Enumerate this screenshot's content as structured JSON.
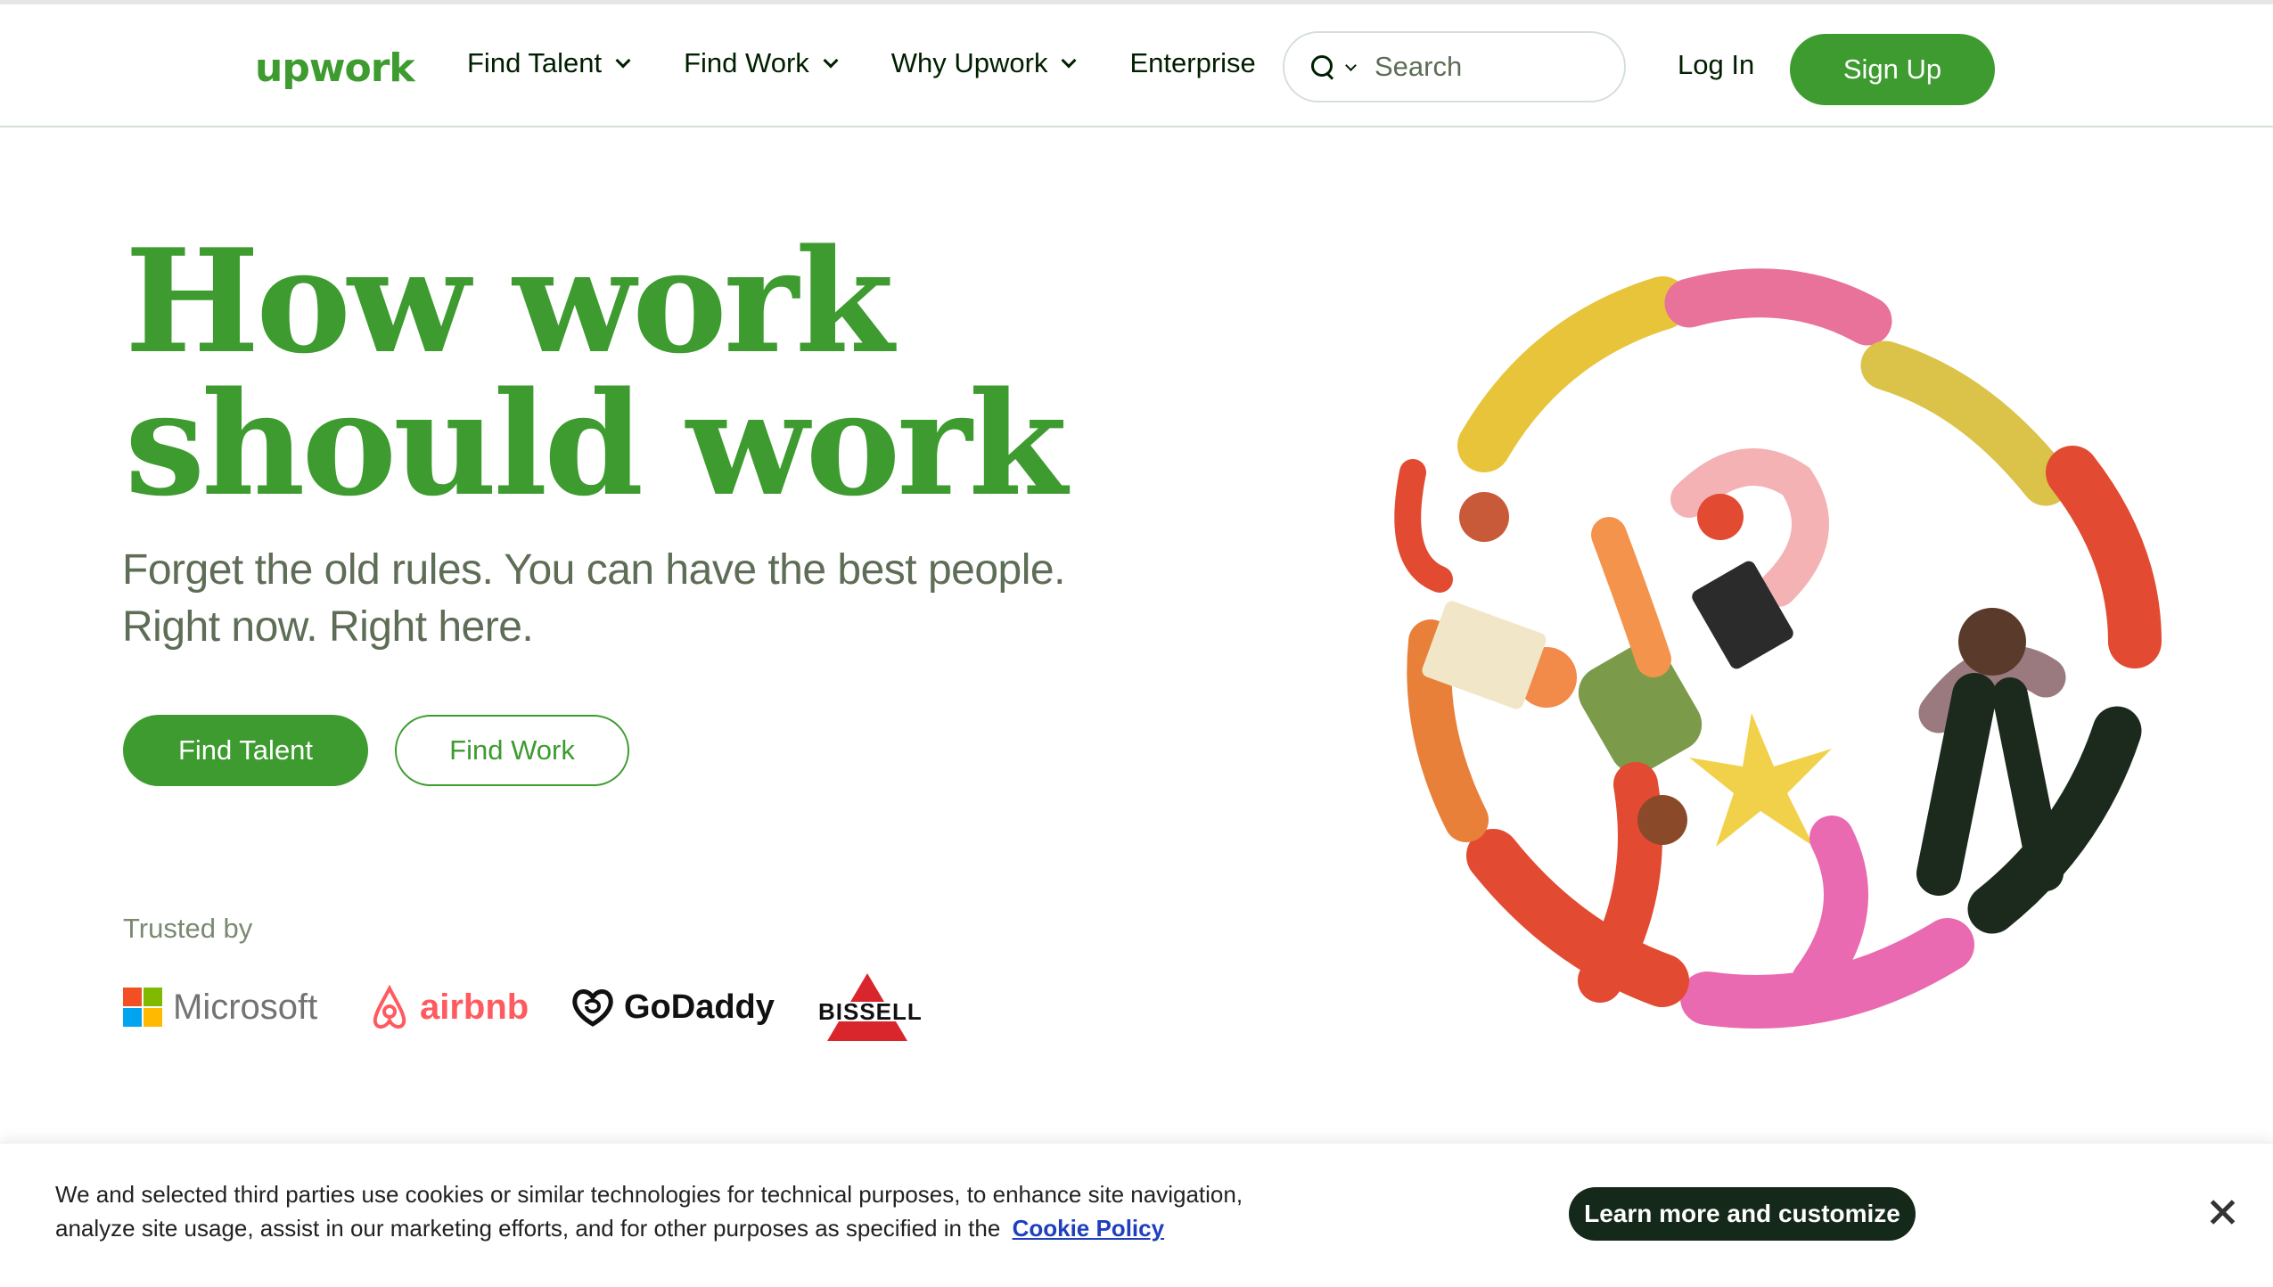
{
  "header": {
    "logo": "upwork",
    "nav": [
      {
        "label": "Find Talent",
        "has_dropdown": true
      },
      {
        "label": "Find Work",
        "has_dropdown": true
      },
      {
        "label": "Why Upwork",
        "has_dropdown": true
      },
      {
        "label": "Enterprise",
        "has_dropdown": false
      }
    ],
    "search": {
      "placeholder": "Search",
      "icon": "search-icon"
    },
    "login_label": "Log In",
    "signup_label": "Sign Up"
  },
  "hero": {
    "title_line1": "How work",
    "title_line2": "should work",
    "subtitle_line1": "Forget the old rules. You can have the best people.",
    "subtitle_line2": "Right now. Right here.",
    "primary_button": "Find Talent",
    "secondary_button": "Find Work",
    "trusted_label": "Trusted by",
    "trusted_logos": [
      {
        "name": "Microsoft",
        "text": "Microsoft"
      },
      {
        "name": "Airbnb",
        "text": "airbnb"
      },
      {
        "name": "GoDaddy",
        "text": "GoDaddy"
      },
      {
        "name": "Bissell",
        "text": "BISSELL"
      }
    ]
  },
  "cookie_banner": {
    "text_line1": "We and selected third parties use cookies or similar technologies for technical purposes, to enhance site navigation,",
    "text_line2": "analyze site usage, assist in our marketing efforts, and for other purposes as specified in the",
    "link_label": "Cookie Policy",
    "button_label": "Learn more and customize",
    "close_icon": "close-icon"
  },
  "colors": {
    "brand_green": "#3d9b2f",
    "text_dark": "#001e00",
    "text_muted": "#5e6d55",
    "cookie_button": "#14291a",
    "link_blue": "#1f3fbf"
  }
}
